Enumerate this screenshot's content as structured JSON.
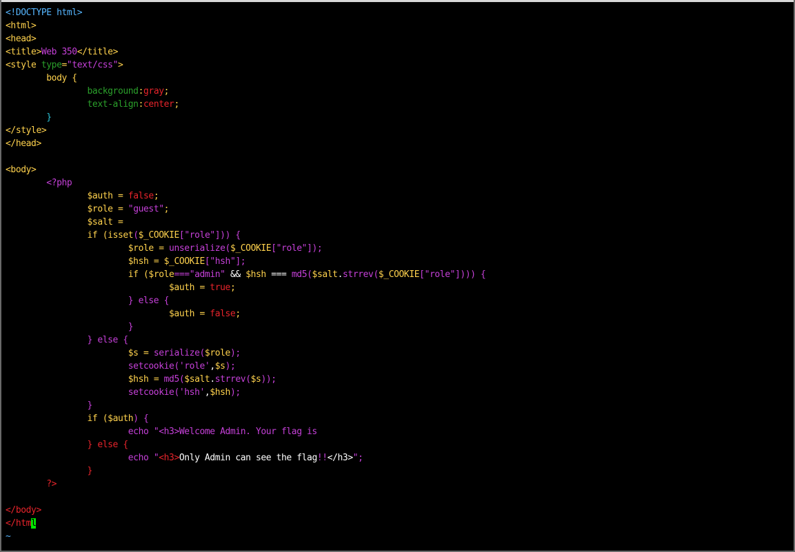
{
  "window": {
    "type": "vim-terminal"
  },
  "colors": {
    "background": "#000000",
    "tag": "#56b6ff",
    "tag_red": "#e8242b",
    "magenta": "#c540d8",
    "green": "#2ba02b",
    "white": "#ffffff",
    "yellow": "#ffd24d",
    "cyan": "#2bc3d6",
    "cursor": "#00e800"
  },
  "editor": {
    "lines": [
      [
        {
          "t": "<!DOCTYPE html>",
          "c": "tag"
        }
      ],
      [
        {
          "t": "<html>",
          "c": "yellow"
        }
      ],
      [
        {
          "t": "<head>",
          "c": "yellow"
        }
      ],
      [
        {
          "t": "<title>",
          "c": "yellow"
        },
        {
          "t": "Web 350",
          "c": "magenta"
        },
        {
          "t": "</title>",
          "c": "yellow"
        }
      ],
      [
        {
          "t": "<style ",
          "c": "yellow"
        },
        {
          "t": "type",
          "c": "green"
        },
        {
          "t": "=",
          "c": "yellow"
        },
        {
          "t": "\"text/css\"",
          "c": "magenta"
        },
        {
          "t": ">",
          "c": "yellow"
        }
      ],
      [
        {
          "t": "        body {",
          "c": "yellow"
        }
      ],
      [
        {
          "t": "                ",
          "c": "white"
        },
        {
          "t": "background",
          "c": "green"
        },
        {
          "t": ":",
          "c": "yellow"
        },
        {
          "t": "gray",
          "c": "tag_red"
        },
        {
          "t": ";",
          "c": "yellow"
        }
      ],
      [
        {
          "t": "                ",
          "c": "white"
        },
        {
          "t": "text-align",
          "c": "green"
        },
        {
          "t": ":",
          "c": "yellow"
        },
        {
          "t": "center",
          "c": "tag_red"
        },
        {
          "t": ";",
          "c": "yellow"
        }
      ],
      [
        {
          "t": "        }",
          "c": "cyan"
        }
      ],
      [
        {
          "t": "</style>",
          "c": "yellow"
        }
      ],
      [
        {
          "t": "</head>",
          "c": "yellow"
        }
      ],
      [
        {
          "t": "",
          "c": "white"
        }
      ],
      [
        {
          "t": "<body>",
          "c": "yellow"
        }
      ],
      [
        {
          "t": "        <?php",
          "c": "magenta"
        }
      ],
      [
        {
          "t": "                ",
          "c": "white"
        },
        {
          "t": "$auth",
          "c": "yellow"
        },
        {
          "t": " = ",
          "c": "yellow"
        },
        {
          "t": "false",
          "c": "tag_red"
        },
        {
          "t": ";",
          "c": "yellow"
        }
      ],
      [
        {
          "t": "                ",
          "c": "white"
        },
        {
          "t": "$role",
          "c": "yellow"
        },
        {
          "t": " = ",
          "c": "yellow"
        },
        {
          "t": "\"guest\"",
          "c": "magenta"
        },
        {
          "t": ";",
          "c": "yellow"
        }
      ],
      [
        {
          "t": "                ",
          "c": "white"
        },
        {
          "t": "$salt",
          "c": "yellow"
        },
        {
          "t": " =",
          "c": "yellow"
        }
      ],
      [
        {
          "t": "                ",
          "c": "white"
        },
        {
          "t": "if (",
          "c": "yellow"
        },
        {
          "t": "isset",
          "c": "yellow"
        },
        {
          "t": "(",
          "c": "magenta"
        },
        {
          "t": "$_COOKIE",
          "c": "yellow"
        },
        {
          "t": "[",
          "c": "magenta"
        },
        {
          "t": "\"role\"",
          "c": "magenta"
        },
        {
          "t": "])) {",
          "c": "magenta"
        }
      ],
      [
        {
          "t": "                        ",
          "c": "white"
        },
        {
          "t": "$role",
          "c": "yellow"
        },
        {
          "t": " = ",
          "c": "yellow"
        },
        {
          "t": "unserialize",
          "c": "magenta"
        },
        {
          "t": "(",
          "c": "magenta"
        },
        {
          "t": "$_COOKIE",
          "c": "yellow"
        },
        {
          "t": "[",
          "c": "magenta"
        },
        {
          "t": "\"role\"",
          "c": "magenta"
        },
        {
          "t": "]);",
          "c": "magenta"
        }
      ],
      [
        {
          "t": "                        ",
          "c": "white"
        },
        {
          "t": "$hsh",
          "c": "yellow"
        },
        {
          "t": " = ",
          "c": "yellow"
        },
        {
          "t": "$_COOKIE",
          "c": "yellow"
        },
        {
          "t": "[",
          "c": "magenta"
        },
        {
          "t": "\"hsh\"",
          "c": "magenta"
        },
        {
          "t": "];",
          "c": "magenta"
        }
      ],
      [
        {
          "t": "                        ",
          "c": "white"
        },
        {
          "t": "if (",
          "c": "yellow"
        },
        {
          "t": "$role",
          "c": "yellow"
        },
        {
          "t": "===",
          "c": "magenta"
        },
        {
          "t": "\"admin\"",
          "c": "magenta"
        },
        {
          "t": " && ",
          "c": "white"
        },
        {
          "t": "$hsh",
          "c": "yellow"
        },
        {
          "t": " === ",
          "c": "white"
        },
        {
          "t": "md5",
          "c": "magenta"
        },
        {
          "t": "(",
          "c": "magenta"
        },
        {
          "t": "$salt",
          "c": "yellow"
        },
        {
          "t": ".",
          "c": "white"
        },
        {
          "t": "strrev",
          "c": "magenta"
        },
        {
          "t": "(",
          "c": "magenta"
        },
        {
          "t": "$_COOKIE",
          "c": "yellow"
        },
        {
          "t": "[",
          "c": "magenta"
        },
        {
          "t": "\"role\"",
          "c": "magenta"
        },
        {
          "t": "]))) {",
          "c": "magenta"
        }
      ],
      [
        {
          "t": "                                ",
          "c": "white"
        },
        {
          "t": "$auth",
          "c": "yellow"
        },
        {
          "t": " = ",
          "c": "yellow"
        },
        {
          "t": "true",
          "c": "tag_red"
        },
        {
          "t": ";",
          "c": "yellow"
        }
      ],
      [
        {
          "t": "                        ",
          "c": "white"
        },
        {
          "t": "} else {",
          "c": "magenta"
        }
      ],
      [
        {
          "t": "                                ",
          "c": "white"
        },
        {
          "t": "$auth",
          "c": "yellow"
        },
        {
          "t": " = ",
          "c": "yellow"
        },
        {
          "t": "false",
          "c": "tag_red"
        },
        {
          "t": ";",
          "c": "yellow"
        }
      ],
      [
        {
          "t": "                        ",
          "c": "white"
        },
        {
          "t": "}",
          "c": "magenta"
        }
      ],
      [
        {
          "t": "                ",
          "c": "white"
        },
        {
          "t": "} else {",
          "c": "magenta"
        }
      ],
      [
        {
          "t": "                        ",
          "c": "white"
        },
        {
          "t": "$s",
          "c": "yellow"
        },
        {
          "t": " = ",
          "c": "yellow"
        },
        {
          "t": "serialize",
          "c": "magenta"
        },
        {
          "t": "(",
          "c": "magenta"
        },
        {
          "t": "$role",
          "c": "yellow"
        },
        {
          "t": ");",
          "c": "magenta"
        }
      ],
      [
        {
          "t": "                        ",
          "c": "white"
        },
        {
          "t": "setcookie",
          "c": "magenta"
        },
        {
          "t": "(",
          "c": "magenta"
        },
        {
          "t": "'role'",
          "c": "magenta"
        },
        {
          "t": ",",
          "c": "white"
        },
        {
          "t": "$s",
          "c": "yellow"
        },
        {
          "t": ");",
          "c": "magenta"
        }
      ],
      [
        {
          "t": "                        ",
          "c": "white"
        },
        {
          "t": "$hsh",
          "c": "yellow"
        },
        {
          "t": " = ",
          "c": "yellow"
        },
        {
          "t": "md5",
          "c": "magenta"
        },
        {
          "t": "(",
          "c": "magenta"
        },
        {
          "t": "$salt",
          "c": "yellow"
        },
        {
          "t": ".",
          "c": "white"
        },
        {
          "t": "strrev",
          "c": "magenta"
        },
        {
          "t": "(",
          "c": "magenta"
        },
        {
          "t": "$s",
          "c": "yellow"
        },
        {
          "t": "));",
          "c": "magenta"
        }
      ],
      [
        {
          "t": "                        ",
          "c": "white"
        },
        {
          "t": "setcookie",
          "c": "magenta"
        },
        {
          "t": "(",
          "c": "magenta"
        },
        {
          "t": "'hsh'",
          "c": "magenta"
        },
        {
          "t": ",",
          "c": "white"
        },
        {
          "t": "$hsh",
          "c": "yellow"
        },
        {
          "t": ");",
          "c": "magenta"
        }
      ],
      [
        {
          "t": "                ",
          "c": "white"
        },
        {
          "t": "}",
          "c": "magenta"
        }
      ],
      [
        {
          "t": "                ",
          "c": "white"
        },
        {
          "t": "if (",
          "c": "yellow"
        },
        {
          "t": "$auth",
          "c": "yellow"
        },
        {
          "t": ") {",
          "c": "magenta"
        }
      ],
      [
        {
          "t": "                        ",
          "c": "white"
        },
        {
          "t": "echo ",
          "c": "magenta"
        },
        {
          "t": "\"",
          "c": "magenta"
        },
        {
          "t": "<h3>Welcome Admin. Your flag is",
          "c": "magenta"
        }
      ],
      [
        {
          "t": "                ",
          "c": "white"
        },
        {
          "t": "} else {",
          "c": "tag_red"
        }
      ],
      [
        {
          "t": "                        ",
          "c": "white"
        },
        {
          "t": "echo ",
          "c": "magenta"
        },
        {
          "t": "\"",
          "c": "magenta"
        },
        {
          "t": "<h3>",
          "c": "tag_red"
        },
        {
          "t": "Only Admin can see the flag",
          "c": "white"
        },
        {
          "t": "!!",
          "c": "magenta"
        },
        {
          "t": "</h3>",
          "c": "white"
        },
        {
          "t": "\";",
          "c": "magenta"
        }
      ],
      [
        {
          "t": "                ",
          "c": "white"
        },
        {
          "t": "}",
          "c": "tag_red"
        }
      ],
      [
        {
          "t": "        ?>",
          "c": "tag_red"
        }
      ],
      [
        {
          "t": "",
          "c": "white"
        }
      ],
      [
        {
          "t": "</body>",
          "c": "tag_red"
        }
      ],
      [
        {
          "t": "</htm",
          "c": "tag_red"
        },
        {
          "t": "l",
          "c": "cursor"
        }
      ],
      [
        {
          "t": "~",
          "c": "tag"
        }
      ]
    ]
  }
}
